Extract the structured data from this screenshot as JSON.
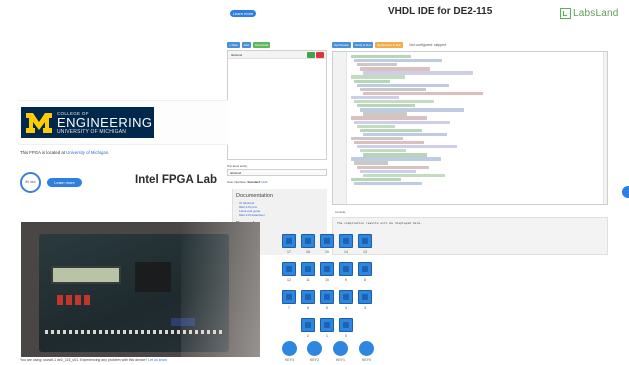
{
  "header": {
    "learn_top_label": "Learn more",
    "ide_title": "VHDL IDE for DE2-115",
    "brand": "LabsLand"
  },
  "ide": {
    "toolbar": [
      {
        "label": "+ New",
        "color": "#4a90d9"
      },
      {
        "label": "Add",
        "color": "#4a90d9"
      },
      {
        "label": "Download",
        "color": "#5cb85c"
      }
    ],
    "file_header": "labsland",
    "top_level_label": "Top-level entity:",
    "top_level_value": "labsland",
    "language_prefix": "User interface: ",
    "language_current": "Standard",
    "language_alt": "VHD",
    "docs_heading": "Documentation",
    "doc_links": [
      "IO labsland",
      "DE2-115 pins",
      "LabsLand guide",
      "DE2-115 datasheet"
    ],
    "examples_heading": "Examples",
    "example_links": [
      "Leds switch"
    ]
  },
  "editor": {
    "toolbar": [
      {
        "label": "Synthesize",
        "color": "#4a90d9"
      },
      {
        "label": "Verify & Run",
        "color": "#4a90d9"
      },
      {
        "label": "Synthesize & Run",
        "color": "#f0ad4e"
      }
    ],
    "status": "Not configured: skipped",
    "console_tab": "console",
    "console_message": "The compilation results will be displayed here."
  },
  "michigan": {
    "college_of": "COLLEGE OF",
    "engineering": "ENGINEERING",
    "university": "UNIVERSITY OF MICHIGAN",
    "located_prefix": "This FPGA is located at ",
    "located_link": "University of Michigan",
    "located_suffix": "."
  },
  "session": {
    "time_remaining": "60 sec",
    "learn_more": "Learn more",
    "lab_title": "Intel FPGA Lab"
  },
  "camera": {
    "note_prefix": "You are using: uscwlt-1 de2_115_u01. Experiencing any problem with this device? ",
    "note_link": "Let us know"
  },
  "switches": {
    "rows": [
      [
        "17",
        "16",
        "15",
        "14",
        "13"
      ],
      [
        "12",
        "11",
        "10",
        "9",
        "8"
      ],
      [
        "7",
        "6",
        "5",
        "4",
        "3"
      ],
      [
        "2",
        "1",
        "0"
      ]
    ]
  },
  "keys": [
    "KEY3",
    "KEY2",
    "KEY1",
    "KEY0"
  ],
  "colors": {
    "accent_blue": "#2f7fe0",
    "switch_blue": "#2e86de",
    "michigan_navy": "#00274c",
    "michigan_maize": "#ffcb05",
    "brand_green": "#52b84b"
  }
}
